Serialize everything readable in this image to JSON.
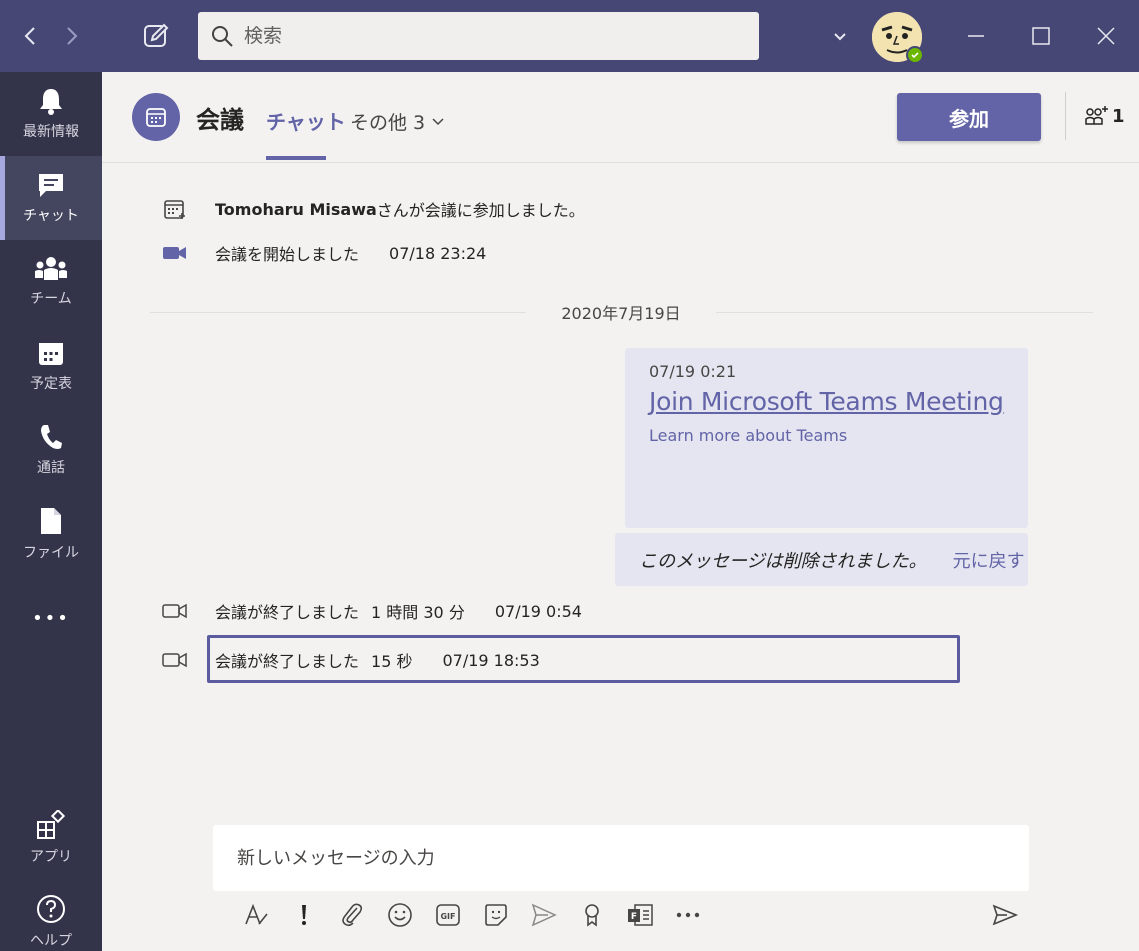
{
  "search": {
    "placeholder": "検索"
  },
  "rail": {
    "items": [
      {
        "label": "最新情報",
        "icon": "bell-icon"
      },
      {
        "label": "チャット",
        "icon": "chat-icon",
        "active": true
      },
      {
        "label": "チーム",
        "icon": "teams-icon"
      },
      {
        "label": "予定表",
        "icon": "calendar-icon"
      },
      {
        "label": "通話",
        "icon": "phone-icon"
      },
      {
        "label": "ファイル",
        "icon": "file-icon"
      }
    ],
    "more": "•••",
    "apps_label": "アプリ",
    "help_label": "ヘルプ"
  },
  "header": {
    "title": "会議",
    "tab_chat": "チャット",
    "tab_more": "その他 3",
    "join_label": "参加",
    "participant_count": "1"
  },
  "messages": {
    "joined_name": "Tomoharu Misawa",
    "joined_text": " さんが会議に参加しました。",
    "started_text": "会議を開始しました",
    "started_time": "07/18 23:24",
    "date_divider": "2020年7月19日",
    "bubble_time": "07/19 0:21",
    "join_link": "Join Microsoft Teams Meeting",
    "learn_more": "Learn more about Teams",
    "deleted_text": "このメッセージは削除されました。",
    "undo_label": "元に戻す",
    "ended1_text": "会議が終了しました",
    "ended1_duration": "1 時間 30 分",
    "ended1_time": "07/19 0:54",
    "ended2_text": "会議が終了しました",
    "ended2_duration": "15 秒",
    "ended2_time": "07/19 18:53"
  },
  "compose": {
    "placeholder": "新しいメッセージの入力"
  },
  "colors": {
    "accent": "#6264a7",
    "titlebar": "#464775",
    "rail": "#33344a",
    "bubble": "#e5e5f1",
    "status": "#6bb700"
  }
}
